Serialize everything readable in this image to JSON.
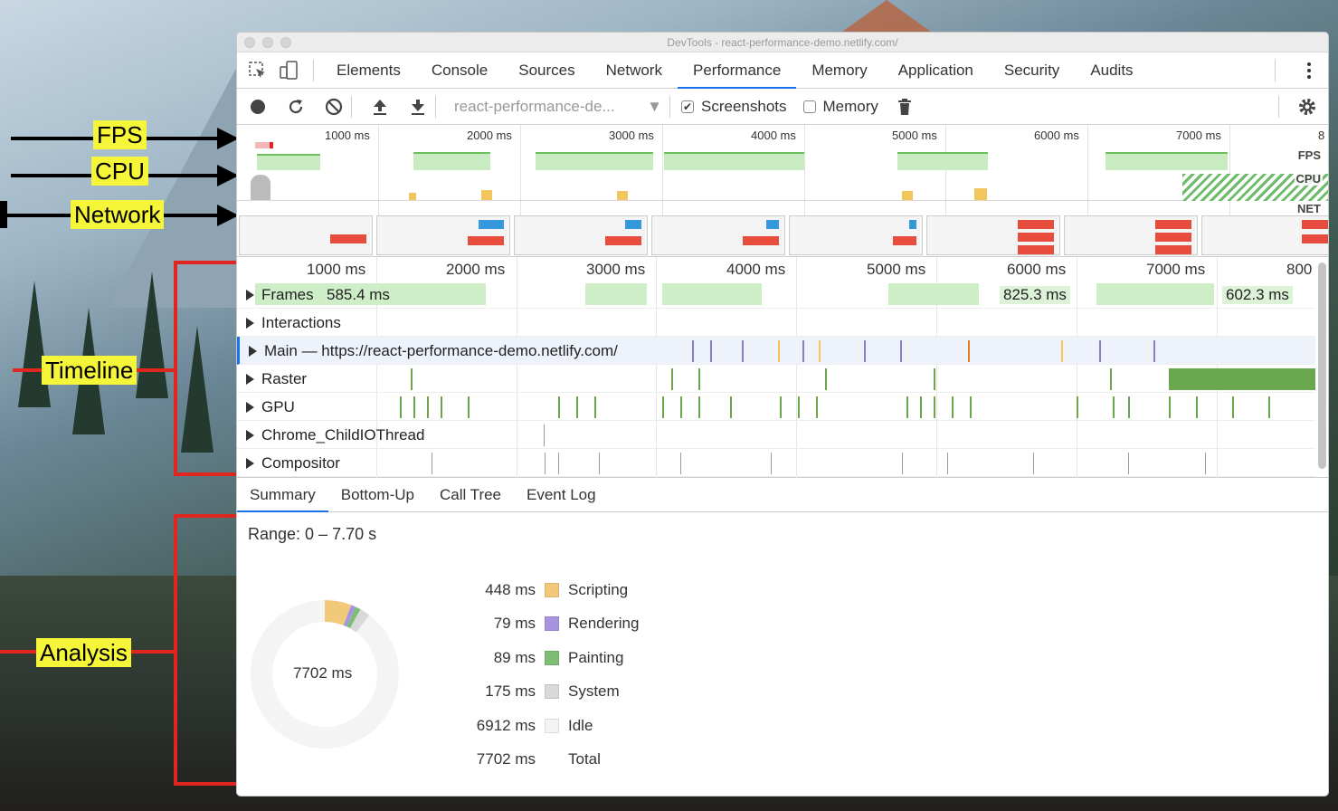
{
  "window": {
    "title": "DevTools - react-performance-demo.netlify.com/"
  },
  "annotations": {
    "fps": "FPS",
    "cpu": "CPU",
    "network": "Network",
    "timeline": "Timeline",
    "analysis": "Analysis"
  },
  "tabs": [
    {
      "label": "Elements"
    },
    {
      "label": "Console"
    },
    {
      "label": "Sources"
    },
    {
      "label": "Network"
    },
    {
      "label": "Performance",
      "active": true
    },
    {
      "label": "Memory"
    },
    {
      "label": "Application"
    },
    {
      "label": "Security"
    },
    {
      "label": "Audits"
    }
  ],
  "toolbar": {
    "profile_select": "react-performance-de...",
    "screenshots_label": "Screenshots",
    "screenshots_checked": true,
    "memory_label": "Memory",
    "memory_checked": false
  },
  "overview": {
    "ticks": [
      "1000 ms",
      "2000 ms",
      "3000 ms",
      "4000 ms",
      "5000 ms",
      "6000 ms",
      "7000 ms",
      "8"
    ],
    "tags": {
      "fps": "FPS",
      "cpu": "CPU",
      "net": "NET"
    }
  },
  "timeline": {
    "ticks": [
      "1000 ms",
      "2000 ms",
      "3000 ms",
      "4000 ms",
      "5000 ms",
      "6000 ms",
      "7000 ms",
      "800"
    ],
    "frame_values": [
      "585.4 ms",
      "825.3 ms",
      "602.3 ms"
    ],
    "tracks": [
      {
        "name": "Frames"
      },
      {
        "name": "Interactions"
      },
      {
        "name": "Main — https://react-performance-demo.netlify.com/"
      },
      {
        "name": "Raster"
      },
      {
        "name": "GPU"
      },
      {
        "name": "Chrome_ChildIOThread"
      },
      {
        "name": "Compositor"
      }
    ]
  },
  "bottom_tabs": [
    {
      "label": "Summary",
      "active": true
    },
    {
      "label": "Bottom-Up"
    },
    {
      "label": "Call Tree"
    },
    {
      "label": "Event Log"
    }
  ],
  "summary": {
    "range": "Range: 0 – 7.70 s",
    "total_center": "7702 ms",
    "items": [
      {
        "value": "448 ms",
        "label": "Scripting",
        "color": "#f2c97a",
        "ms": 448
      },
      {
        "value": "79 ms",
        "label": "Rendering",
        "color": "#a794e0",
        "ms": 79
      },
      {
        "value": "89 ms",
        "label": "Painting",
        "color": "#7dbe74",
        "ms": 89
      },
      {
        "value": "175 ms",
        "label": "System",
        "color": "#d9d9d9",
        "ms": 175
      },
      {
        "value": "6912 ms",
        "label": "Idle",
        "color": "#f4f4f4",
        "ms": 6912
      },
      {
        "value": "7702 ms",
        "label": "Total",
        "color": "",
        "ms": 7702
      }
    ]
  }
}
